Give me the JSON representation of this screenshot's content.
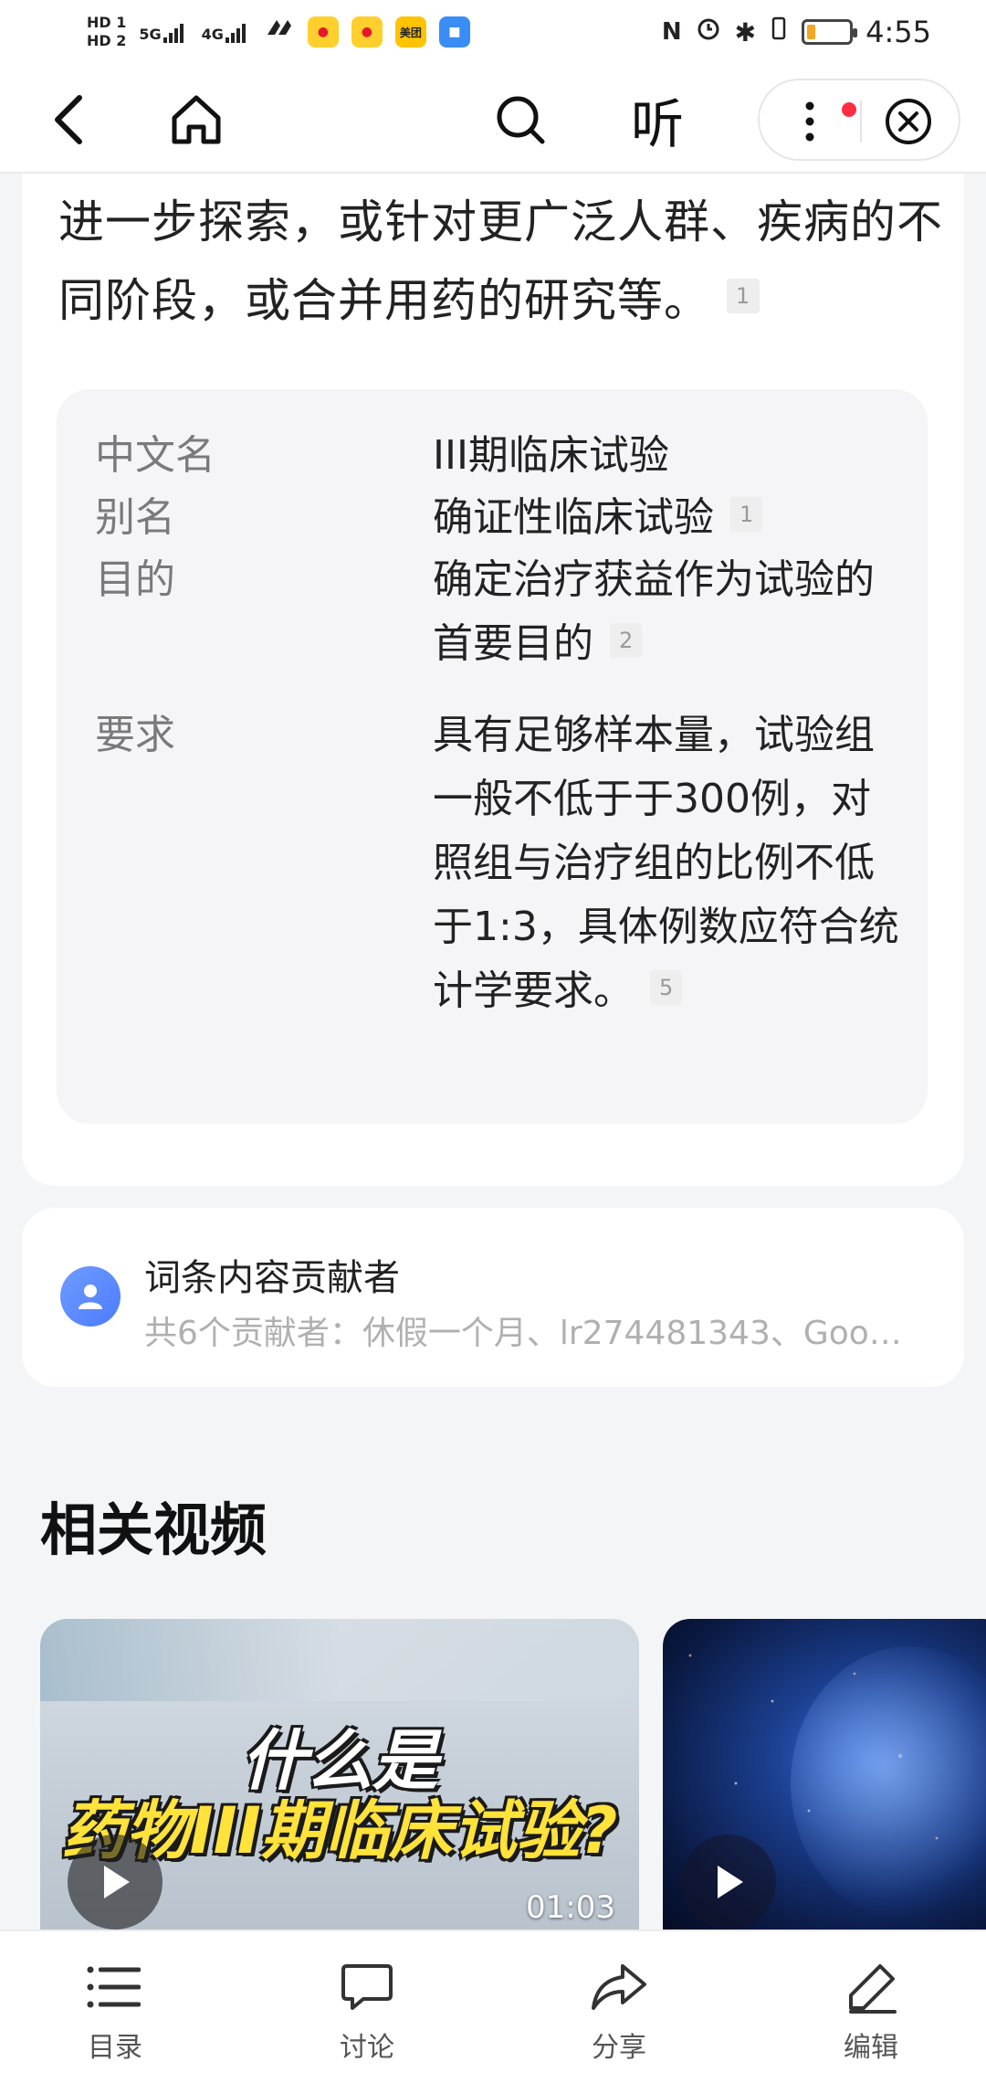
{
  "status_bar": {
    "hd1": "HD 1",
    "hd2": "HD 2",
    "net1": "5G",
    "net2": "4G",
    "app_meituan": "美团",
    "time": "4:55",
    "battery_percent": 20
  },
  "top_nav": {
    "listen_label": "听"
  },
  "article": {
    "lead_text": "进一步探索，或针对更广泛人群、疾病的不同阶段，或合并用药的研究等。",
    "lead_ref": "1"
  },
  "info_box": {
    "rows": [
      {
        "label": "中文名",
        "value": "III期临床试验",
        "ref": ""
      },
      {
        "label": "别名",
        "value": "确证性临床试验",
        "ref": "1"
      },
      {
        "label": "目的",
        "value": "确定治疗获益作为试验的首要目的",
        "ref": "2"
      },
      {
        "label": "要求",
        "value": "具有足够样本量，试验组一般不低于于300例，对照组与治疗组的比例不低于1:3，具体例数应符合统计学要求。",
        "ref": "5"
      }
    ]
  },
  "contributors": {
    "title": "词条内容贡献者",
    "subtitle": "共6个贡献者：休假一个月、lr274481343、Goo…"
  },
  "related_videos": {
    "title": "相关视频",
    "videos": [
      {
        "title_line1": "什么是",
        "title_line2": "药物III期临床试验?",
        "duration": "01:03"
      },
      {
        "title_line1": "",
        "title_line2": "",
        "duration": ""
      }
    ]
  },
  "bottom_bar": {
    "items": [
      {
        "label": "目录",
        "icon": "list-icon"
      },
      {
        "label": "讨论",
        "icon": "comment-icon"
      },
      {
        "label": "分享",
        "icon": "share-icon"
      },
      {
        "label": "编辑",
        "icon": "edit-icon"
      }
    ]
  }
}
